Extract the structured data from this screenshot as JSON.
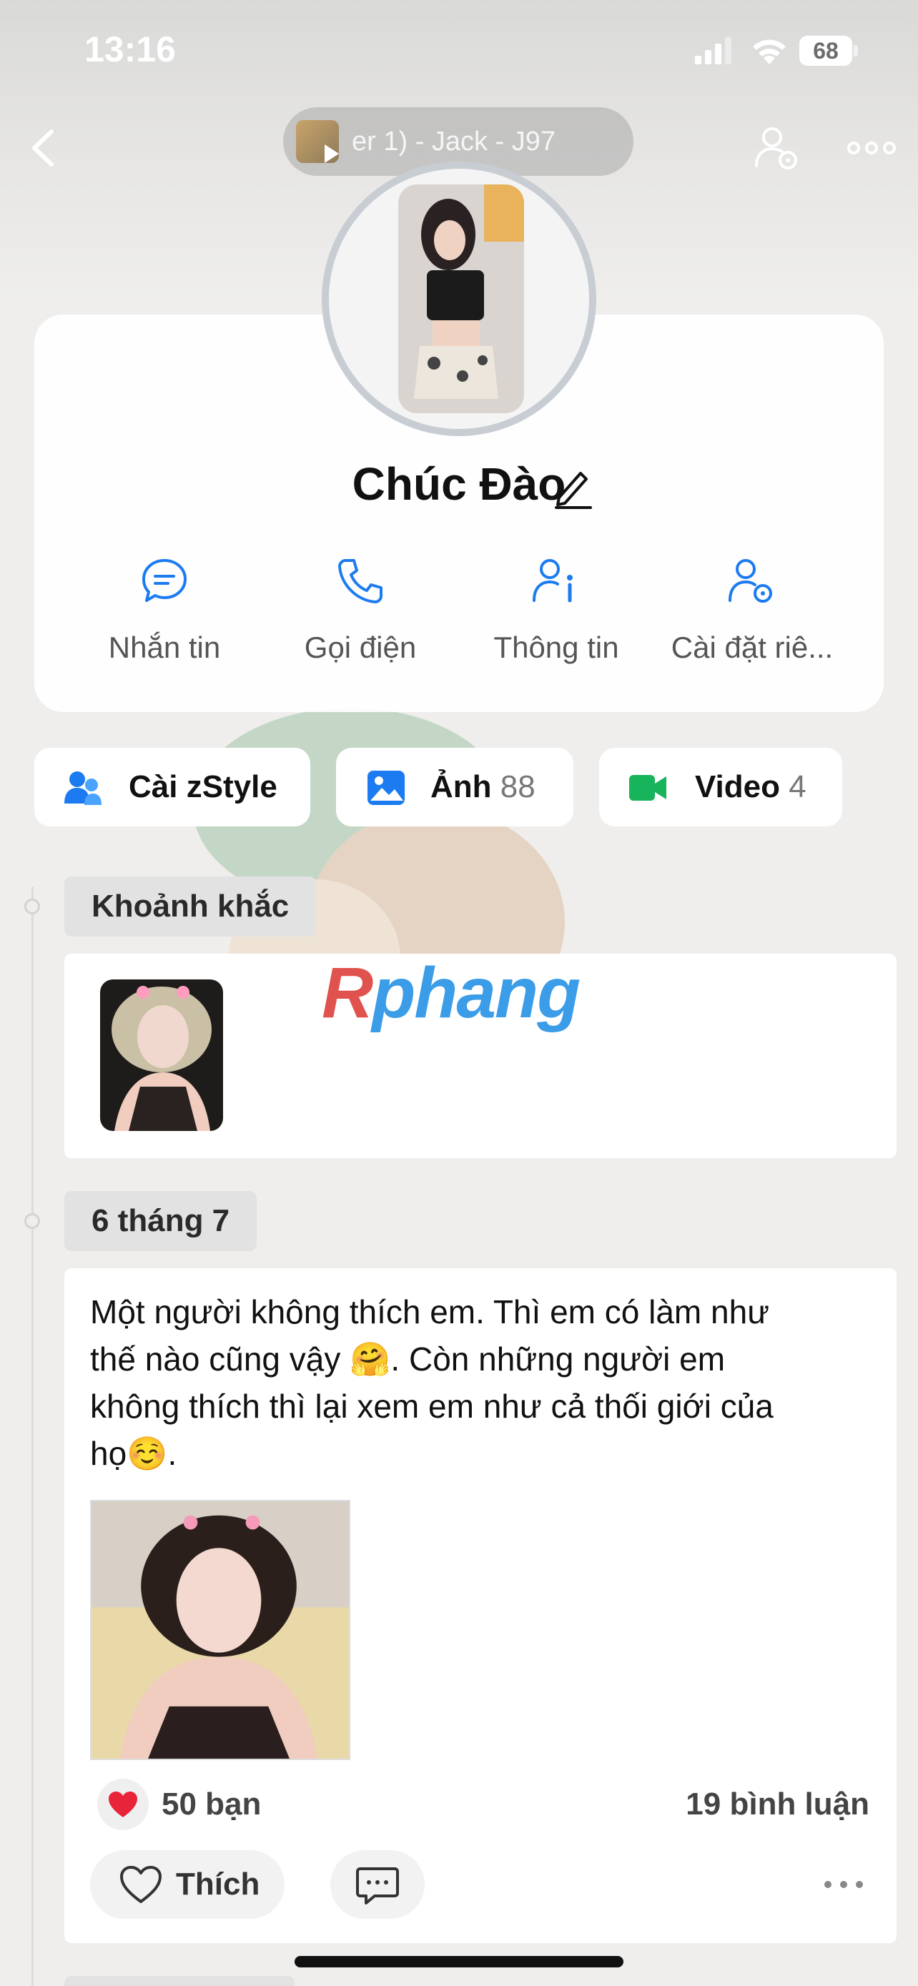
{
  "status_bar": {
    "time": "13:16",
    "battery": "68"
  },
  "nav": {
    "music_text": "er 1) - Jack - J97"
  },
  "profile": {
    "name": "Chúc Đào"
  },
  "actions": [
    {
      "label": "Nhắn tin",
      "icon": "chat-bubble-icon"
    },
    {
      "label": "Gọi điện",
      "icon": "phone-icon"
    },
    {
      "label": "Thông tin",
      "icon": "user-info-icon"
    },
    {
      "label": "Cài đặt riê...",
      "icon": "user-settings-icon"
    }
  ],
  "chips": {
    "zstyle": {
      "label": "Cài zStyle"
    },
    "photos": {
      "label": "Ảnh",
      "count": "88"
    },
    "videos": {
      "label": "Video",
      "count": "4"
    }
  },
  "timeline": {
    "moments_label": "Khoảnh khắc",
    "date_label": "6 tháng 7"
  },
  "watermark": {
    "part_a": "R",
    "part_b": "phang"
  },
  "post": {
    "text": "Một người không thích em. Thì em có làm như\nthế nào cũng vậy 🤗. Còn những người em\nkhông thích thì lại xem em như cả thối giới của\nhọ☺️.",
    "likes": "50 bạn",
    "comments": "19 bình luận",
    "like_label": "Thích"
  },
  "colors": {
    "accent": "#1c7bf0",
    "video_green": "#17b45c",
    "heart_red": "#e8243b"
  }
}
